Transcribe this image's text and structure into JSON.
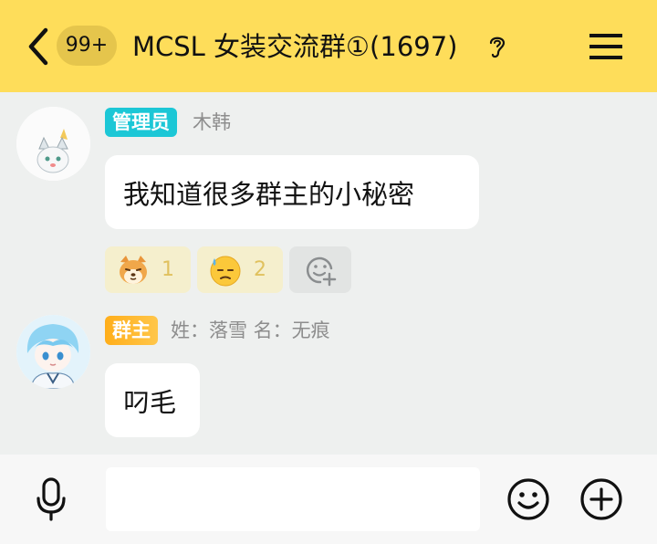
{
  "header": {
    "unread_count": "99+",
    "group_title": "MCSL 女装交流群①(1697)",
    "icons": [
      "back-icon",
      "ear-icon",
      "menu-icon"
    ]
  },
  "messages": [
    {
      "role": "管理员",
      "sender": "木韩",
      "text": "我知道很多群主的小秘密",
      "role_color": "#1cc7d6",
      "reactions": [
        {
          "icon": "shiba-dog-emoji",
          "count": "1"
        },
        {
          "icon": "sweat-face-emoji",
          "count": "2"
        }
      ]
    },
    {
      "role": "群主",
      "sender": "姓：落雪 名：无痕",
      "text": "叼毛",
      "role_color": "#ffae1a"
    }
  ],
  "input_bar": {
    "placeholder": "",
    "icons": [
      "microphone-icon",
      "smiley-icon",
      "plus-icon"
    ]
  },
  "colors": {
    "header_bg": "#fedd5a",
    "chat_bg": "#eef0ef",
    "reaction_bg": "#f5efcd"
  }
}
